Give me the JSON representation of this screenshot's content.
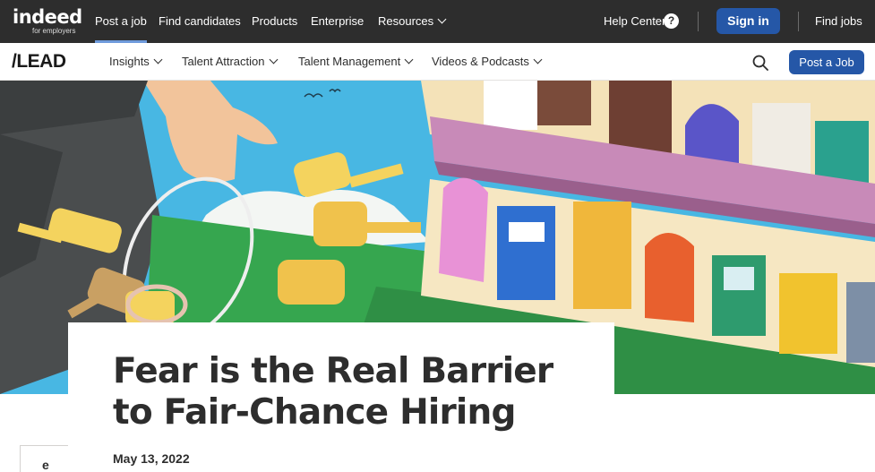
{
  "topbar": {
    "logo_word": "indeed",
    "logo_sub": "for employers",
    "nav": [
      "Post a job",
      "Find candidates",
      "Products",
      "Enterprise",
      "Resources"
    ],
    "help_label": "Help Center",
    "help_icon_glyph": "?",
    "signin_label": "Sign in",
    "findjobs_label": "Find jobs"
  },
  "subbar": {
    "brand": "/LEAD",
    "nav": [
      "Insights",
      "Talent Attraction",
      "Talent Management",
      "Videos & Podcasts"
    ],
    "postjob_label": "Post a Job"
  },
  "article": {
    "title": "Fear is the Real Barrier to Fair-Chance Hiring",
    "date": "May 13, 2022"
  },
  "side_tab": {
    "letter": "e"
  },
  "colors": {
    "topbar_bg": "#2d2d2d",
    "brand_blue": "#2557a7",
    "active_underline": "#6f9bdc",
    "text_dark": "#2d2d2d"
  },
  "icons": {
    "help": "question-circle-icon",
    "search": "search-icon",
    "dropdown": "chevron-down-icon"
  }
}
